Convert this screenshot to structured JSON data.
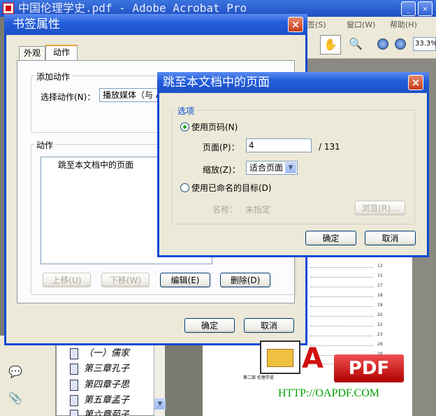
{
  "app": {
    "title": "中国伦理学史.pdf - Adobe Acrobat Pro",
    "menu": [
      "签(S)",
      "窗口(W)",
      "帮助(H)"
    ],
    "zoom": "33.3%",
    "page_heading": "第二部 伦理学说"
  },
  "bookmarks": [
    {
      "label": "（一）儒家"
    },
    {
      "label": "第三章孔子"
    },
    {
      "label": "第四章子思"
    },
    {
      "label": "第五章孟子"
    },
    {
      "label": "第六章荀子"
    }
  ],
  "toc_page_numbers": [
    "13",
    "15",
    "17",
    "18",
    "19",
    "20",
    "22",
    "23",
    "26",
    "28",
    "29"
  ],
  "bookmark_dialog": {
    "title": "书签属性",
    "tabs": [
      "外观",
      "动作"
    ],
    "add_action_group": "添加动作",
    "select_action_label": "选择动作(N)：",
    "select_action_value": "播放媒体（与 Acr",
    "actions_group": "动作",
    "actions_list": [
      "跳至本文档中的页面"
    ],
    "buttons": {
      "up": "上移(U)",
      "down": "下移(W)",
      "edit": "编辑(E)",
      "delete": "删除(D)",
      "ok": "确定",
      "cancel": "取消"
    }
  },
  "goto_dialog": {
    "title": "跳至本文档中的页面",
    "options_group": "选项",
    "use_page_number": "使用页码(N)",
    "page_label": "页面(P)：",
    "page_value": "4",
    "page_total": "/ 131",
    "zoom_label": "缩放(Z)：",
    "zoom_value": "适合页面",
    "use_named_dest": "使用已命名的目标(D)",
    "name_label": "名称：",
    "name_value": "未指定",
    "browse": "浏览(R)...",
    "ok": "确定",
    "cancel": "取消"
  },
  "watermark": {
    "brand_a": "A",
    "brand_pdf": "PDF",
    "url": "HTTP://OAPDF.COM"
  }
}
